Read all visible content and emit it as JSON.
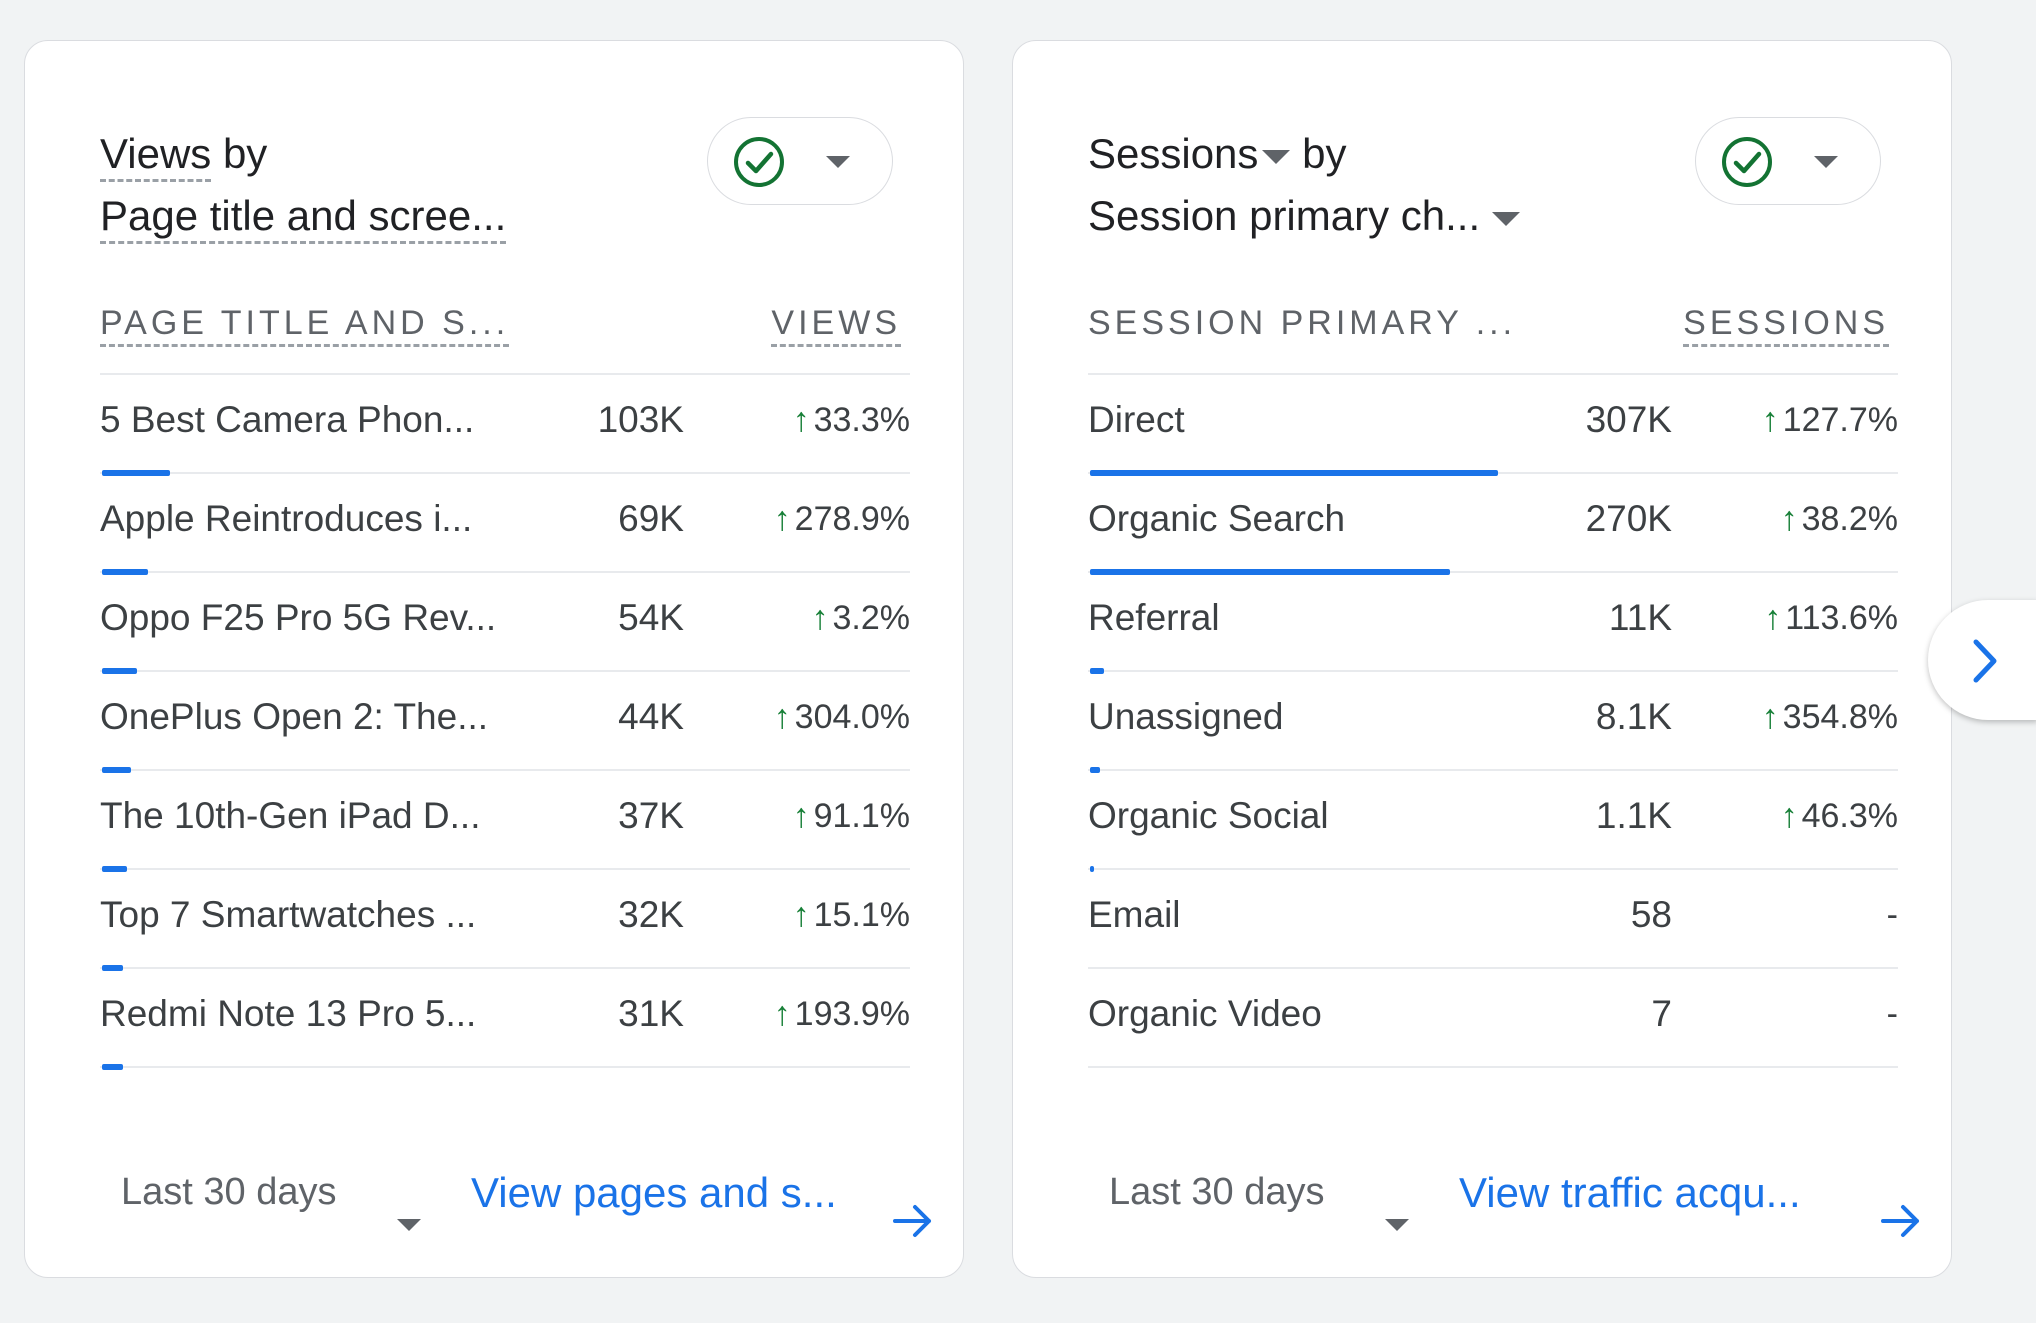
{
  "left_card": {
    "title_metric": "Views",
    "title_by": " by",
    "title_dimension": "Page title and scree...",
    "col_dimension": "PAGE TITLE AND S...",
    "col_metric": "VIEWS",
    "rows": [
      {
        "name": "5 Best Camera Phon...",
        "value": "103K",
        "change": "33.3%",
        "bar_fraction": 0.085
      },
      {
        "name": "Apple Reintroduces i...",
        "value": "69K",
        "change": "278.9%",
        "bar_fraction": 0.057
      },
      {
        "name": "Oppo F25 Pro 5G Rev...",
        "value": "54K",
        "change": "3.2%",
        "bar_fraction": 0.044
      },
      {
        "name": "OnePlus Open 2: The...",
        "value": "44K",
        "change": "304.0%",
        "bar_fraction": 0.036
      },
      {
        "name": "The 10th-Gen iPad D...",
        "value": "37K",
        "change": "91.1%",
        "bar_fraction": 0.031
      },
      {
        "name": "Top 7 Smartwatches ...",
        "value": "32K",
        "change": "15.1%",
        "bar_fraction": 0.026
      },
      {
        "name": "Redmi Note 13 Pro 5...",
        "value": "31K",
        "change": "193.9%",
        "bar_fraction": 0.026
      }
    ],
    "date_range": "Last 30 days",
    "view_link": "View pages and s..."
  },
  "right_card": {
    "title_metric": "Sessions",
    "title_by": " by",
    "title_dimension": "Session primary ch...",
    "col_dimension": "SESSION PRIMARY ...",
    "col_metric": "SESSIONS",
    "rows": [
      {
        "name": "Direct",
        "value": "307K",
        "change": "127.7%",
        "bar_fraction": 0.51
      },
      {
        "name": "Organic Search",
        "value": "270K",
        "change": "38.2%",
        "bar_fraction": 0.45
      },
      {
        "name": "Referral",
        "value": "11K",
        "change": "113.6%",
        "bar_fraction": 0.018
      },
      {
        "name": "Unassigned",
        "value": "8.1K",
        "change": "354.8%",
        "bar_fraction": 0.013
      },
      {
        "name": "Organic Social",
        "value": "1.1K",
        "change": "46.3%",
        "bar_fraction": 0.003
      },
      {
        "name": "Email",
        "value": "58",
        "change": "-",
        "bar_fraction": 0
      },
      {
        "name": "Organic Video",
        "value": "7",
        "change": "-",
        "bar_fraction": 0
      }
    ],
    "date_range": "Last 30 days",
    "view_link": "View traffic acqu..."
  },
  "icons": {
    "status": "check-circle-icon",
    "next": "chevron-right-icon",
    "link_arrow": "arrow-right-icon"
  },
  "colors": {
    "accent": "#1a73e8",
    "positive": "#188038",
    "check": "#137333"
  }
}
